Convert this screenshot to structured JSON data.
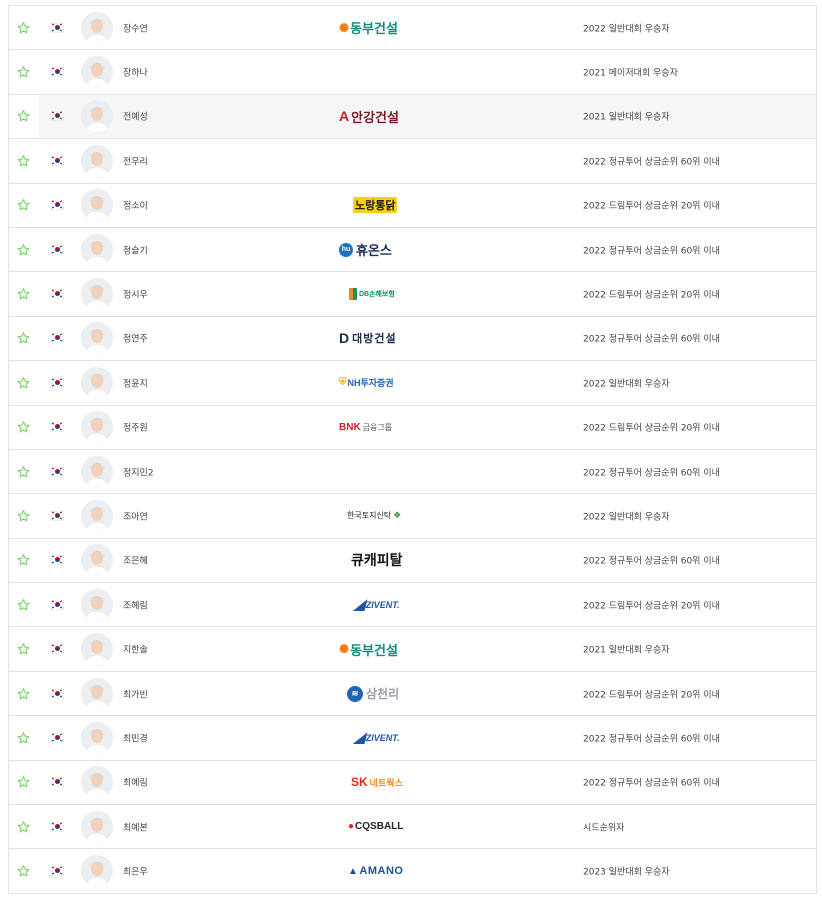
{
  "colors": {
    "star": "#7bd36a",
    "border": "#e3e3e3",
    "highlight_row": "#f6f6f6"
  },
  "icons": {
    "favorite": "star-outline-icon",
    "nationality": "korea-flag-icon",
    "player_photo": "player-avatar"
  },
  "players": [
    {
      "name": "장수연",
      "qualification": "2022 일반대회 우승자",
      "sponsor": {
        "type": "dongbu",
        "text": "동부건설"
      }
    },
    {
      "name": "장하나",
      "qualification": "2021 메이저대회 우승자",
      "sponsor": null
    },
    {
      "name": "전예성",
      "qualification": "2021 일반대회 우승자",
      "sponsor": {
        "type": "angang",
        "text": "안강건설"
      },
      "highlight": true
    },
    {
      "name": "전우리",
      "qualification": "2022 정규투어 상금순위 60위 이내",
      "sponsor": null
    },
    {
      "name": "정소이",
      "qualification": "2022 드림투어 상금순위 20위 이내",
      "sponsor": {
        "type": "nojang",
        "text": "노랑통닭"
      }
    },
    {
      "name": "정슬기",
      "qualification": "2022 정규투어 상금순위 60위 이내",
      "sponsor": {
        "type": "huons",
        "text": "휴온스"
      }
    },
    {
      "name": "정시우",
      "qualification": "2022 드림투어 상금순위 20위 이내",
      "sponsor": {
        "type": "db",
        "text": "DB손해보험"
      }
    },
    {
      "name": "정연주",
      "qualification": "2022 정규투어 상금순위 60위 이내",
      "sponsor": {
        "type": "daebang",
        "text": "대방건설"
      }
    },
    {
      "name": "정윤지",
      "qualification": "2022 일반대회 우승자",
      "sponsor": {
        "type": "nh",
        "text": "NH투자증권"
      }
    },
    {
      "name": "정주원",
      "qualification": "2022 드림투어 상금순위 20위 이내",
      "sponsor": {
        "type": "bnk",
        "text": "BNK",
        "sub": "금융그룹"
      }
    },
    {
      "name": "정지민2",
      "qualification": "2022 정규투어 상금순위 60위 이내",
      "sponsor": null
    },
    {
      "name": "조아연",
      "qualification": "2022 일반대회 우승자",
      "sponsor": {
        "type": "land",
        "text": "한국토지신탁"
      }
    },
    {
      "name": "조은혜",
      "qualification": "2022 정규투어 상금순위 60위 이내",
      "sponsor": {
        "type": "q",
        "text": "큐캐피탈"
      }
    },
    {
      "name": "조혜림",
      "qualification": "2022 드림투어 상금순위 20위 이내",
      "sponsor": {
        "type": "zivent",
        "text": "ZIVENT."
      }
    },
    {
      "name": "지한솔",
      "qualification": "2021 일반대회 우승자",
      "sponsor": {
        "type": "dongbu",
        "text": "동부건설"
      }
    },
    {
      "name": "최가빈",
      "qualification": "2022 드림투어 상금순위 20위 이내",
      "sponsor": {
        "type": "samchully",
        "text": "삼천리"
      }
    },
    {
      "name": "최민경",
      "qualification": "2022 정규투어 상금순위 60위 이내",
      "sponsor": {
        "type": "zivent",
        "text": "ZIVENT."
      }
    },
    {
      "name": "최예림",
      "qualification": "2022 정규투어 상금순위 60위 이내",
      "sponsor": {
        "type": "sk",
        "text": "SK",
        "sub": "네트웍스"
      }
    },
    {
      "name": "최예본",
      "qualification": "시드순위자",
      "sponsor": {
        "type": "cqs",
        "text": "CQSBALL"
      }
    },
    {
      "name": "최은우",
      "qualification": "2023 일반대회 우승자",
      "sponsor": {
        "type": "amano",
        "text": "AMANO"
      }
    }
  ]
}
